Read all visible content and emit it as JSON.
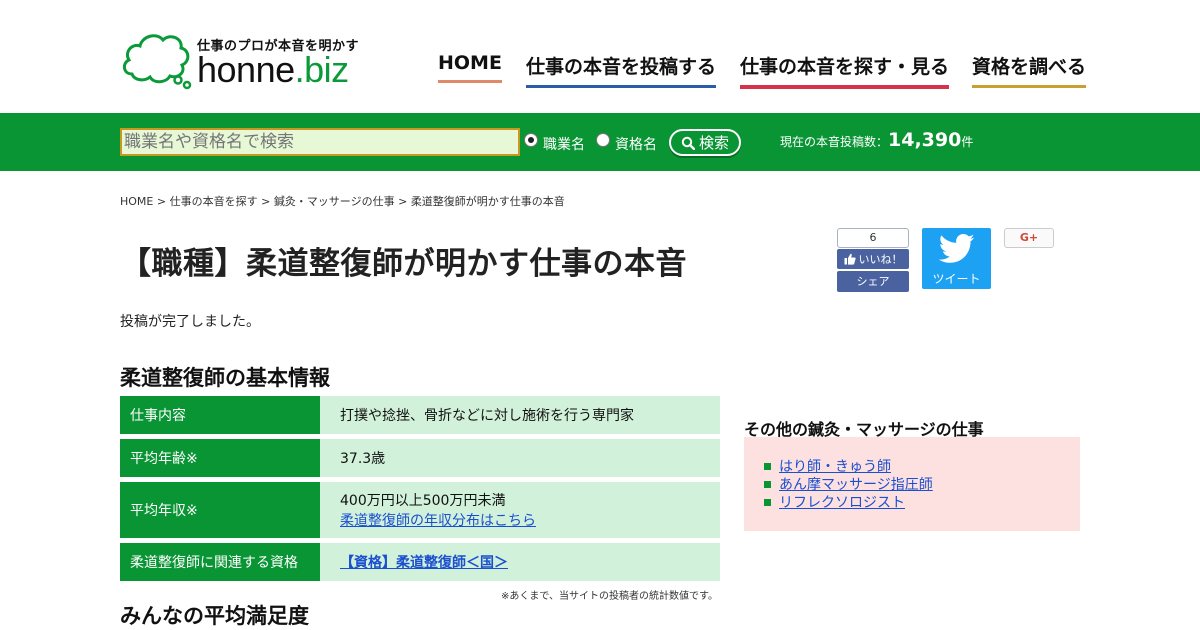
{
  "header": {
    "logo_tagline": "仕事のプロが本音を明かす",
    "logo_name": "honne",
    "logo_suffix": ".biz",
    "nav": [
      {
        "label": "HOME"
      },
      {
        "label": "仕事の本音を投稿する"
      },
      {
        "label": "仕事の本音を探す・見る"
      },
      {
        "label": "資格を調べる"
      }
    ]
  },
  "search": {
    "placeholder": "職業名や資格名で検索",
    "radio_options": [
      {
        "label": "職業名",
        "checked": true
      },
      {
        "label": "資格名",
        "checked": false
      }
    ],
    "button_label": "検索",
    "post_count_prefix": "現在の本音投稿数：",
    "post_count_value": "14,390",
    "post_count_suffix": "件"
  },
  "breadcrumb": [
    {
      "label": "HOME"
    },
    {
      "label": "仕事の本音を探す"
    },
    {
      "label": "鍼灸・マッサージの仕事"
    },
    {
      "label": "柔道整復師が明かす仕事の本音"
    }
  ],
  "breadcrumb_separator": " > ",
  "page_title": "【職種】柔道整復師が明かす仕事の本音",
  "social": {
    "fb_count": "6",
    "fb_like_label": "いいね！",
    "fb_share_label": "シェア",
    "tweet_label": "ツイート",
    "gplus_label": "G+"
  },
  "status_message": "投稿が完了しました。",
  "basic_info": {
    "title": "柔道整復師の基本情報",
    "rows": [
      {
        "label": "仕事内容",
        "value": "打撲や捻挫、骨折などに対し施術を行う専門家"
      },
      {
        "label": "平均年齢※",
        "value": "37.3歳"
      },
      {
        "label": "平均年収※",
        "value": "400万円以上500万円未満",
        "link": "柔道整復師の年収分布はこちら"
      },
      {
        "label": "柔道整復師に関連する資格",
        "link": "【資格】柔道整復師＜国＞"
      }
    ],
    "footnote": "※あくまで、当サイトの投稿者の統計数値です。"
  },
  "satisfaction_title": "みんなの平均満足度",
  "sidebar": {
    "title": "その他の鍼灸・マッサージの仕事",
    "items": [
      {
        "label": "はり師・きゅう師"
      },
      {
        "label": "あん摩マッサージ指圧師"
      },
      {
        "label": "リフレクソロジスト"
      }
    ]
  },
  "colors": {
    "brand_green": "#0a9534",
    "light_green": "#d2f1da",
    "sidebar_pink": "#fde0e0",
    "link_blue": "#1a4fd0",
    "twitter_blue": "#1da1f2",
    "facebook_blue": "#4a63a0"
  }
}
